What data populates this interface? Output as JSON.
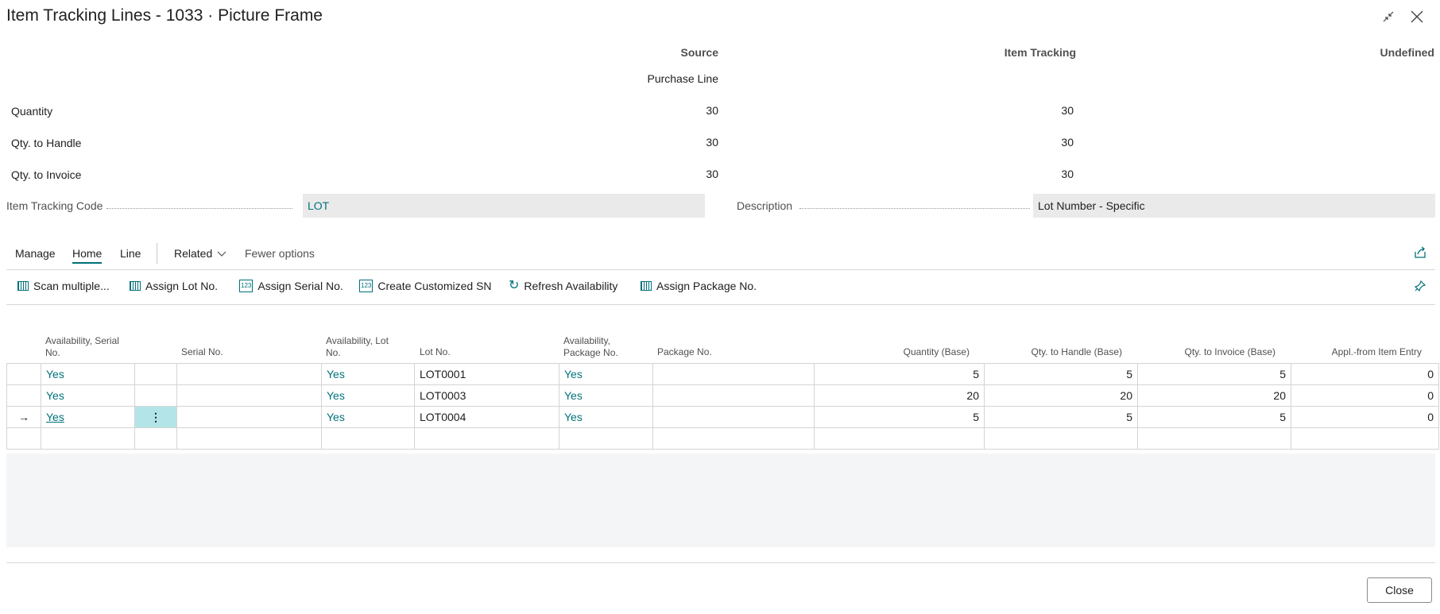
{
  "window": {
    "title": "Item Tracking Lines - 1033 · Picture Frame",
    "collapse_icon": "collapse-icon",
    "close_icon": "close-icon"
  },
  "summary": {
    "col_source": "Source",
    "col_item_tracking": "Item Tracking",
    "col_undefined": "Undefined",
    "source_sub": "Purchase Line",
    "rows": [
      {
        "label": "Quantity",
        "source": "30",
        "tracking": "30"
      },
      {
        "label": "Qty. to Handle",
        "source": "30",
        "tracking": "30"
      },
      {
        "label": "Qty. to Invoice",
        "source": "30",
        "tracking": "30"
      }
    ]
  },
  "fields": {
    "tracking_code_label": "Item Tracking Code",
    "tracking_code_value": "LOT",
    "description_label": "Description",
    "description_value": "Lot Number - Specific"
  },
  "menu": {
    "manage": "Manage",
    "home": "Home",
    "line": "Line",
    "related": "Related",
    "fewer": "Fewer options"
  },
  "actions": {
    "scan": "Scan multiple...",
    "assign_lot": "Assign Lot No.",
    "assign_serial": "Assign Serial No.",
    "create_sn": "Create Customized SN",
    "refresh": "Refresh Availability",
    "assign_package": "Assign Package No."
  },
  "table": {
    "headers": {
      "avail_serial": "Availability, Serial No.",
      "serial_no": "Serial No.",
      "avail_lot": "Availability, Lot No.",
      "lot_no": "Lot No.",
      "avail_package": "Availability, Package No.",
      "package_no": "Package No.",
      "qty_base": "Quantity (Base)",
      "qty_handle_base": "Qty. to Handle (Base)",
      "qty_invoice_base": "Qty. to Invoice (Base)",
      "appl_from": "Appl.-from Item Entry"
    },
    "rows": [
      {
        "avail_serial": "Yes",
        "serial_no": "",
        "avail_lot": "Yes",
        "lot_no": "LOT0001",
        "avail_package": "Yes",
        "package_no": "",
        "qty_base": "5",
        "qty_handle_base": "5",
        "qty_invoice_base": "5",
        "appl_from": "0"
      },
      {
        "avail_serial": "Yes",
        "serial_no": "",
        "avail_lot": "Yes",
        "lot_no": "LOT0003",
        "avail_package": "Yes",
        "package_no": "",
        "qty_base": "20",
        "qty_handle_base": "20",
        "qty_invoice_base": "20",
        "appl_from": "0"
      },
      {
        "avail_serial": "Yes",
        "serial_no": "",
        "avail_lot": "Yes",
        "lot_no": "LOT0004",
        "avail_package": "Yes",
        "package_no": "",
        "qty_base": "5",
        "qty_handle_base": "5",
        "qty_invoice_base": "5",
        "appl_from": "0"
      }
    ]
  },
  "footer": {
    "close": "Close"
  },
  "colors": {
    "accent": "#00727a",
    "selected_cell": "#b2e4e8"
  }
}
